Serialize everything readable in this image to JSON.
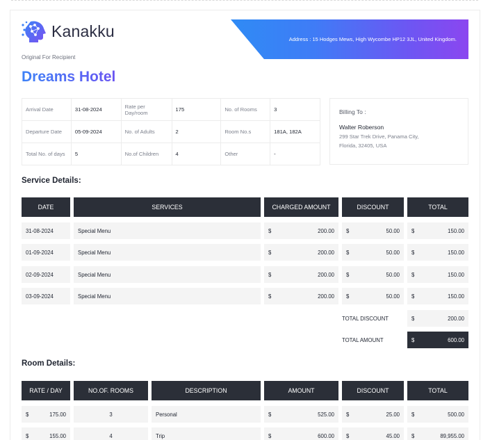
{
  "brand": {
    "name": "Kanakku",
    "logo_icon": "head-network-icon"
  },
  "recipient_label": "Original For Recipient",
  "address": "Address : 15 Hodges Mews, High Wycombe HP12 3JL, United Kingdom.",
  "hotel_name": "Dreams Hotel",
  "colors": {
    "accent_start": "#3d82f7",
    "accent_end": "#8b46f0",
    "header_dark": "#2b2f38"
  },
  "stay_info": [
    [
      {
        "label": "Arrival Date",
        "value": "31-08-2024"
      },
      {
        "label": "Rate per Day/room",
        "value": "175"
      },
      {
        "label": "No. of Rooms",
        "value": "3"
      }
    ],
    [
      {
        "label": "Departure Date",
        "value": "05-09-2024"
      },
      {
        "label": "No. of Adults",
        "value": "2"
      },
      {
        "label": "Room No.s",
        "value": "181A, 182A"
      }
    ],
    [
      {
        "label": "Total No. of days",
        "value": "5"
      },
      {
        "label": "No.of Children",
        "value": "4"
      },
      {
        "label": "Other",
        "value": "-"
      }
    ]
  ],
  "billing": {
    "title": "Billing To :",
    "name": "Walter Roberson",
    "address": "299 Star Trek Drive, Panama City, Florida, 32405, USA"
  },
  "service_details": {
    "title": "Service Details:",
    "headers": [
      "DATE",
      "SERVICES",
      "CHARGED AMOUNT",
      "DISCOUNT",
      "TOTAL"
    ],
    "currency": "$",
    "rows": [
      {
        "date": "31-08-2024",
        "service": "Special Menu",
        "charged": "200.00",
        "discount": "50.00",
        "total": "150.00"
      },
      {
        "date": "01-09-2024",
        "service": "Special Menu",
        "charged": "200.00",
        "discount": "50.00",
        "total": "150.00"
      },
      {
        "date": "02-09-2024",
        "service": "Special Menu",
        "charged": "200.00",
        "discount": "50.00",
        "total": "150.00"
      },
      {
        "date": "03-09-2024",
        "service": "Special Menu",
        "charged": "200.00",
        "discount": "50.00",
        "total": "150.00"
      }
    ],
    "total_discount_label": "TOTAL DISCOUNT",
    "total_discount": "200.00",
    "total_amount_label": "TOTAL AMOUNT",
    "total_amount": "600.00"
  },
  "room_details": {
    "title": "Room Details:",
    "headers": [
      "RATE / DAY",
      "NO.OF. ROOMS",
      "DESCRIPTION",
      "AMOUNT",
      "DISCOUNT",
      "TOTAL"
    ],
    "currency": "$",
    "rows": [
      {
        "rate": "175.00",
        "rooms": "3",
        "description": "Personal",
        "amount": "525.00",
        "discount": "25.00",
        "total": "500.00"
      },
      {
        "rate": "155.00",
        "rooms": "4",
        "description": "Trip",
        "amount": "600.00",
        "discount": "45.00",
        "total": "89,955.00"
      }
    ]
  }
}
